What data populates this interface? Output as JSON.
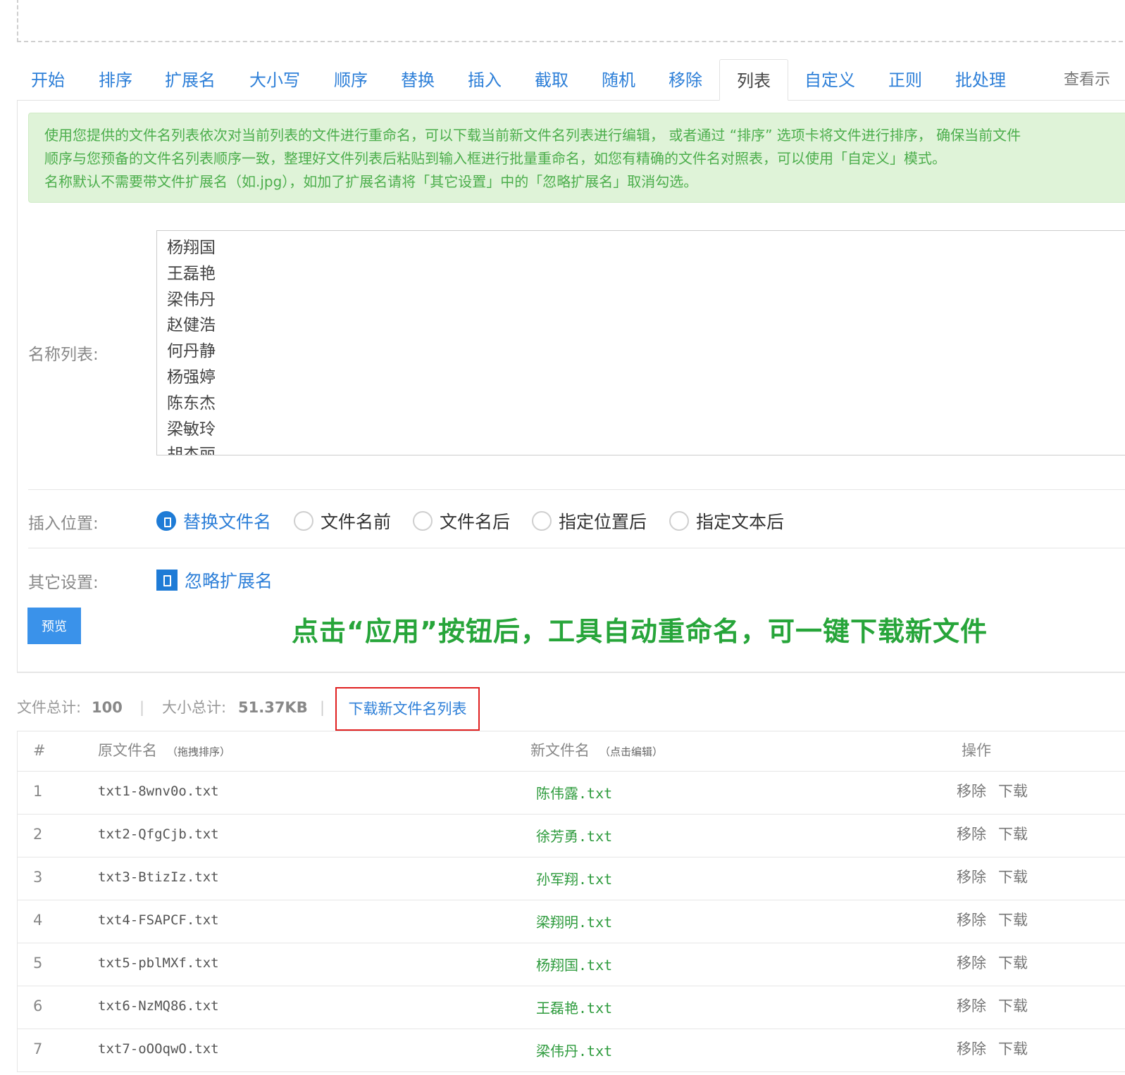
{
  "tabs": [
    {
      "label": "开始",
      "name": "tab-start"
    },
    {
      "label": "排序",
      "name": "tab-sort"
    },
    {
      "label": "扩展名",
      "name": "tab-extension"
    },
    {
      "label": "大小写",
      "name": "tab-case"
    },
    {
      "label": "顺序",
      "name": "tab-order"
    },
    {
      "label": "替换",
      "name": "tab-replace"
    },
    {
      "label": "插入",
      "name": "tab-insert"
    },
    {
      "label": "截取",
      "name": "tab-substring"
    },
    {
      "label": "随机",
      "name": "tab-random"
    },
    {
      "label": "移除",
      "name": "tab-remove"
    },
    {
      "label": "列表",
      "name": "tab-list"
    },
    {
      "label": "自定义",
      "name": "tab-custom"
    },
    {
      "label": "正则",
      "name": "tab-regex"
    },
    {
      "label": "批处理",
      "name": "tab-batch"
    }
  ],
  "active_tab": "列表",
  "more_tab": "查看示",
  "alert": {
    "line1": "使用您提供的文件名列表依次对当前列表的文件进行重命名，可以下载当前新文件名列表进行编辑， 或者通过 “排序” 选项卡将文件进行排序， 确保当前文件",
    "line2": "顺序与您预备的文件名列表顺序一致，整理好文件列表后粘贴到输入框进行批量重命名，如您有精确的文件名对照表，可以使用「自定义」模式。",
    "line3": "名称默认不需要带文件扩展名（如.jpg），如加了扩展名请将「其它设置」中的「忽略扩展名」取消勾选。"
  },
  "names_label": "名称列表:",
  "names_list": [
    "杨翔国",
    "王磊艳",
    "梁伟丹",
    "赵健浩",
    "何丹静",
    "杨强婷",
    "陈东杰",
    "梁敏玲",
    "胡杰丽"
  ],
  "insert_label": "插入位置:",
  "insert_options": [
    {
      "label": "替换文件名",
      "checked": true
    },
    {
      "label": "文件名前",
      "checked": false
    },
    {
      "label": "文件名后",
      "checked": false
    },
    {
      "label": "指定位置后",
      "checked": false
    },
    {
      "label": "指定文本后",
      "checked": false
    }
  ],
  "other_label": "其它设置:",
  "ignore_ext_label": "忽略扩展名",
  "ignore_ext_checked": true,
  "preview_button": "预览",
  "annotation": "点击“应用”按钮后，工具自动重命名，可一键下载新文件",
  "stats": {
    "file_total_label": "文件总计:",
    "file_total": "100",
    "size_total_label": "大小总计:",
    "size_total": "51.37KB",
    "separator": "|",
    "download_list": "下载新文件名列表"
  },
  "table": {
    "headers": {
      "num": "#",
      "orig": "原文件名",
      "orig_hint": "（拖拽排序）",
      "new": "新文件名",
      "new_hint": "（点击编辑）",
      "ops": "操作"
    },
    "rows": [
      {
        "num": "1",
        "orig": "txt1-8wnv0o.txt",
        "new": "陈伟露.txt"
      },
      {
        "num": "2",
        "orig": "txt2-QfgCjb.txt",
        "new": "徐芳勇.txt"
      },
      {
        "num": "3",
        "orig": "txt3-BtizIz.txt",
        "new": "孙军翔.txt"
      },
      {
        "num": "4",
        "orig": "txt4-FSAPCF.txt",
        "new": "梁翔明.txt"
      },
      {
        "num": "5",
        "orig": "txt5-pblMXf.txt",
        "new": "杨翔国.txt"
      },
      {
        "num": "6",
        "orig": "txt6-NzMQ86.txt",
        "new": "王磊艳.txt"
      },
      {
        "num": "7",
        "orig": "txt7-oOOqwO.txt",
        "new": "梁伟丹.txt"
      }
    ],
    "action_remove": "移除",
    "action_download": "下载"
  },
  "colors": {
    "link": "#2d7fd8",
    "primary": "#3a92ea",
    "alert_bg": "#dff3d8",
    "alert_text": "#4cae4c",
    "annotation": "#27a53a",
    "highlight_box": "#e02020",
    "new_name": "#2e9b3d"
  }
}
